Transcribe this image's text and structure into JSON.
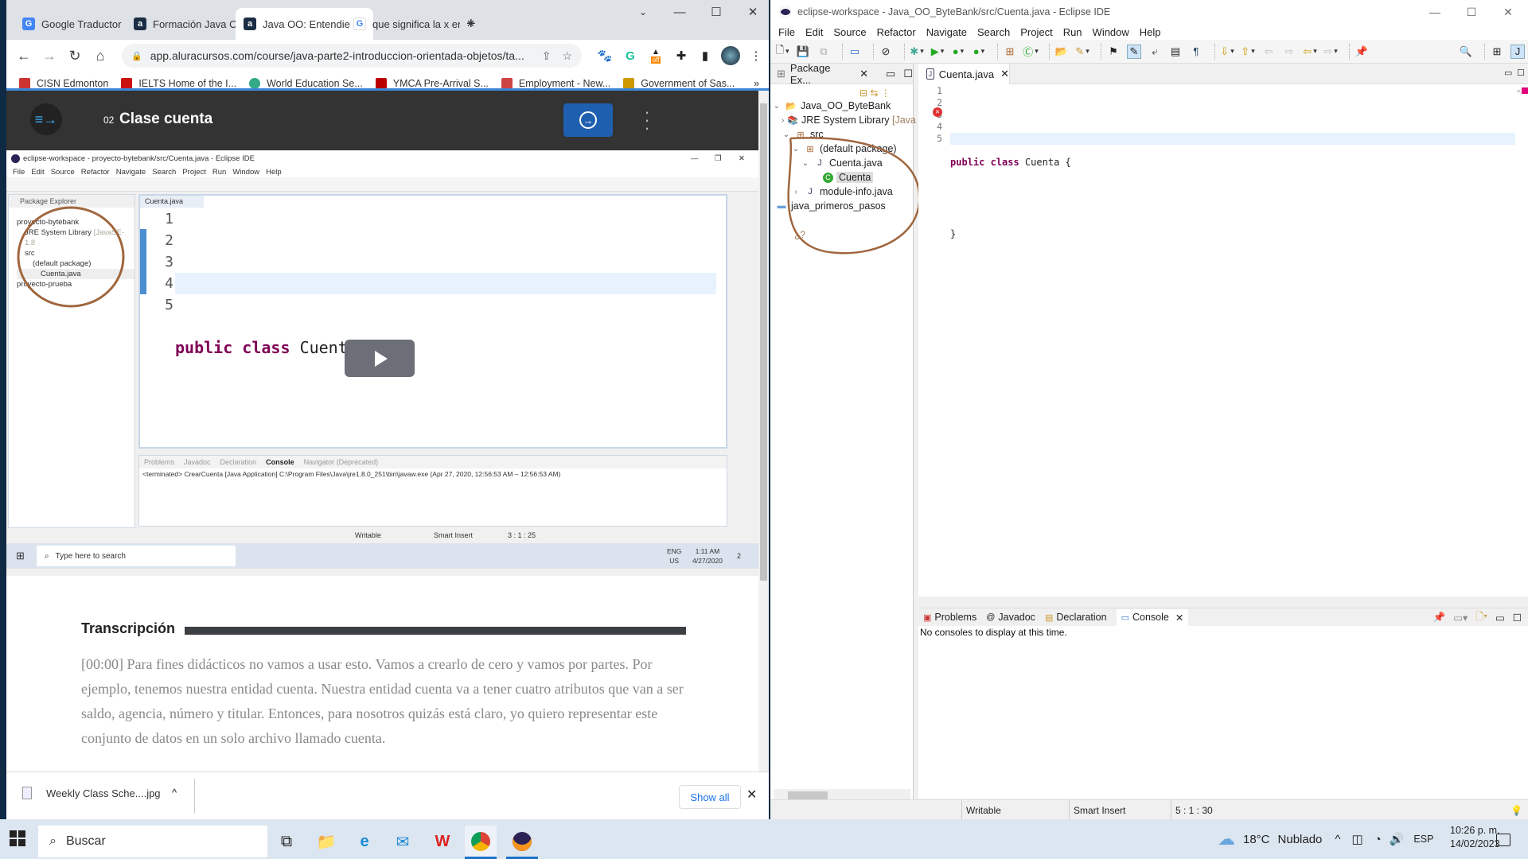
{
  "browser": {
    "tabs": [
      {
        "title": "Google Traductor",
        "icon": "google-translate-icon"
      },
      {
        "title": "Formación Java Orie",
        "icon": "alura-icon"
      },
      {
        "title": "Java OO: Entendiend",
        "icon": "alura-icon",
        "active": true
      },
      {
        "title": "que significa la x en",
        "icon": "google-icon"
      }
    ],
    "new_tab": "+",
    "url": "app.aluracursos.com/course/java-parte2-introduccion-orientada-objetos/ta...",
    "extension_badge": "off",
    "bookmarks": [
      {
        "label": "CISN Edmonton",
        "color": "#c33"
      },
      {
        "label": "IELTS Home of the I...",
        "color": "#c11"
      },
      {
        "label": "World Education Se...",
        "color": "#3a8"
      },
      {
        "label": "YMCA Pre-Arrival S...",
        "color": "#b00"
      },
      {
        "label": "Employment - New...",
        "color": "#c44"
      },
      {
        "label": "Government of Sas...",
        "color": "#c90"
      }
    ],
    "bookmarks_overflow": "»"
  },
  "lesson": {
    "number": "02",
    "title": "Clase cuenta"
  },
  "video": {
    "window_title": "eclipse-workspace - proyecto-bytebank/src/Cuenta.java - Eclipse IDE",
    "menu": [
      "File",
      "Edit",
      "Source",
      "Refactor",
      "Navigate",
      "Search",
      "Project",
      "Run",
      "Window",
      "Help"
    ],
    "package_explorer_title": "Package Explorer",
    "tree": [
      {
        "label": "proyecto-bytebank",
        "indent": 0
      },
      {
        "label": "JRE System Library",
        "suffix": "[JavaSE-1.8",
        "indent": 1
      },
      {
        "label": "src",
        "indent": 1
      },
      {
        "label": "(default package)",
        "indent": 2
      },
      {
        "label": "Cuenta.java",
        "indent": 3
      },
      {
        "label": "proyecto-prueba",
        "indent": 0
      }
    ],
    "editor_tab": "Cuenta.java",
    "line_numbers": [
      "1",
      "2",
      "3",
      "4",
      "5"
    ],
    "code_lines": [
      "",
      "public class Cuenta {",
      "",
      "}",
      ""
    ],
    "console_tabs": [
      "Problems",
      "Javadoc",
      "Declaration",
      "Console",
      "Navigator (Deprecated)"
    ],
    "console_text": "<terminated> CrearCuenta [Java Application] C:\\Program Files\\Java\\jre1.8.0_251\\bin\\javaw.exe  (Apr 27, 2020, 12:56:53 AM – 12:56:53 AM)",
    "status": {
      "writable": "Writable",
      "insert": "Smart Insert",
      "position": "3 : 1 : 25"
    },
    "taskbar_search": "Type here to search",
    "lang": "ENG\nUS",
    "lang_top": "ENG",
    "lang_bottom": "US",
    "time": "1:11 AM",
    "date": "4/27/2020",
    "notif_count": "2"
  },
  "transcript": {
    "heading": "Transcripción",
    "text": "[00:00] Para fines didácticos no vamos a usar esto. Vamos a crearlo de cero y vamos por partes. Por ejemplo, tenemos nuestra entidad cuenta. Nuestra entidad cuenta va a tener cuatro atributos que van a ser saldo, agencia, número y titular. Entonces, para nosotros quizás está claro, yo quiero representar este conjunto de datos en un solo archivo llamado cuenta."
  },
  "downloads": {
    "file": "Weekly Class Sche....jpg",
    "show_all": "Show all"
  },
  "eclipse": {
    "window_title": "eclipse-workspace - Java_OO_ByteBank/src/Cuenta.java - Eclipse IDE",
    "menu": [
      "File",
      "Edit",
      "Source",
      "Refactor",
      "Navigate",
      "Search",
      "Project",
      "Run",
      "Window",
      "Help"
    ],
    "package_explorer_title": "Package Ex...",
    "tree": [
      {
        "label": "Java_OO_ByteBank",
        "expanded": true
      },
      {
        "label": "JRE System Library",
        "suffix": "[Java"
      },
      {
        "label": "src",
        "expanded": true
      },
      {
        "label": "(default package)",
        "expanded": true
      },
      {
        "label": "Cuenta.java",
        "expanded": true
      },
      {
        "label": "Cuenta",
        "selected": true
      },
      {
        "label": "module-info.java"
      },
      {
        "label": "java_primeros_pasos"
      }
    ],
    "annotation": "¿?",
    "editor_tab": "Cuenta.java",
    "line_numbers": [
      "1",
      "2",
      "3",
      "4",
      "5"
    ],
    "code_lines": [
      "",
      "public class Cuenta {",
      "",
      "}",
      ""
    ],
    "console_tabs": [
      "Problems",
      "Javadoc",
      "Declaration",
      "Console"
    ],
    "console_message": "No consoles to display at this time.",
    "status": {
      "writable": "Writable",
      "insert": "Smart Insert",
      "position": "5 : 1 : 30"
    }
  },
  "taskbar": {
    "search_placeholder": "Buscar",
    "weather_temp": "18°C",
    "weather_desc": "Nublado",
    "language": "ESP",
    "time": "10:26 p. m.",
    "date": "14/02/2023"
  }
}
